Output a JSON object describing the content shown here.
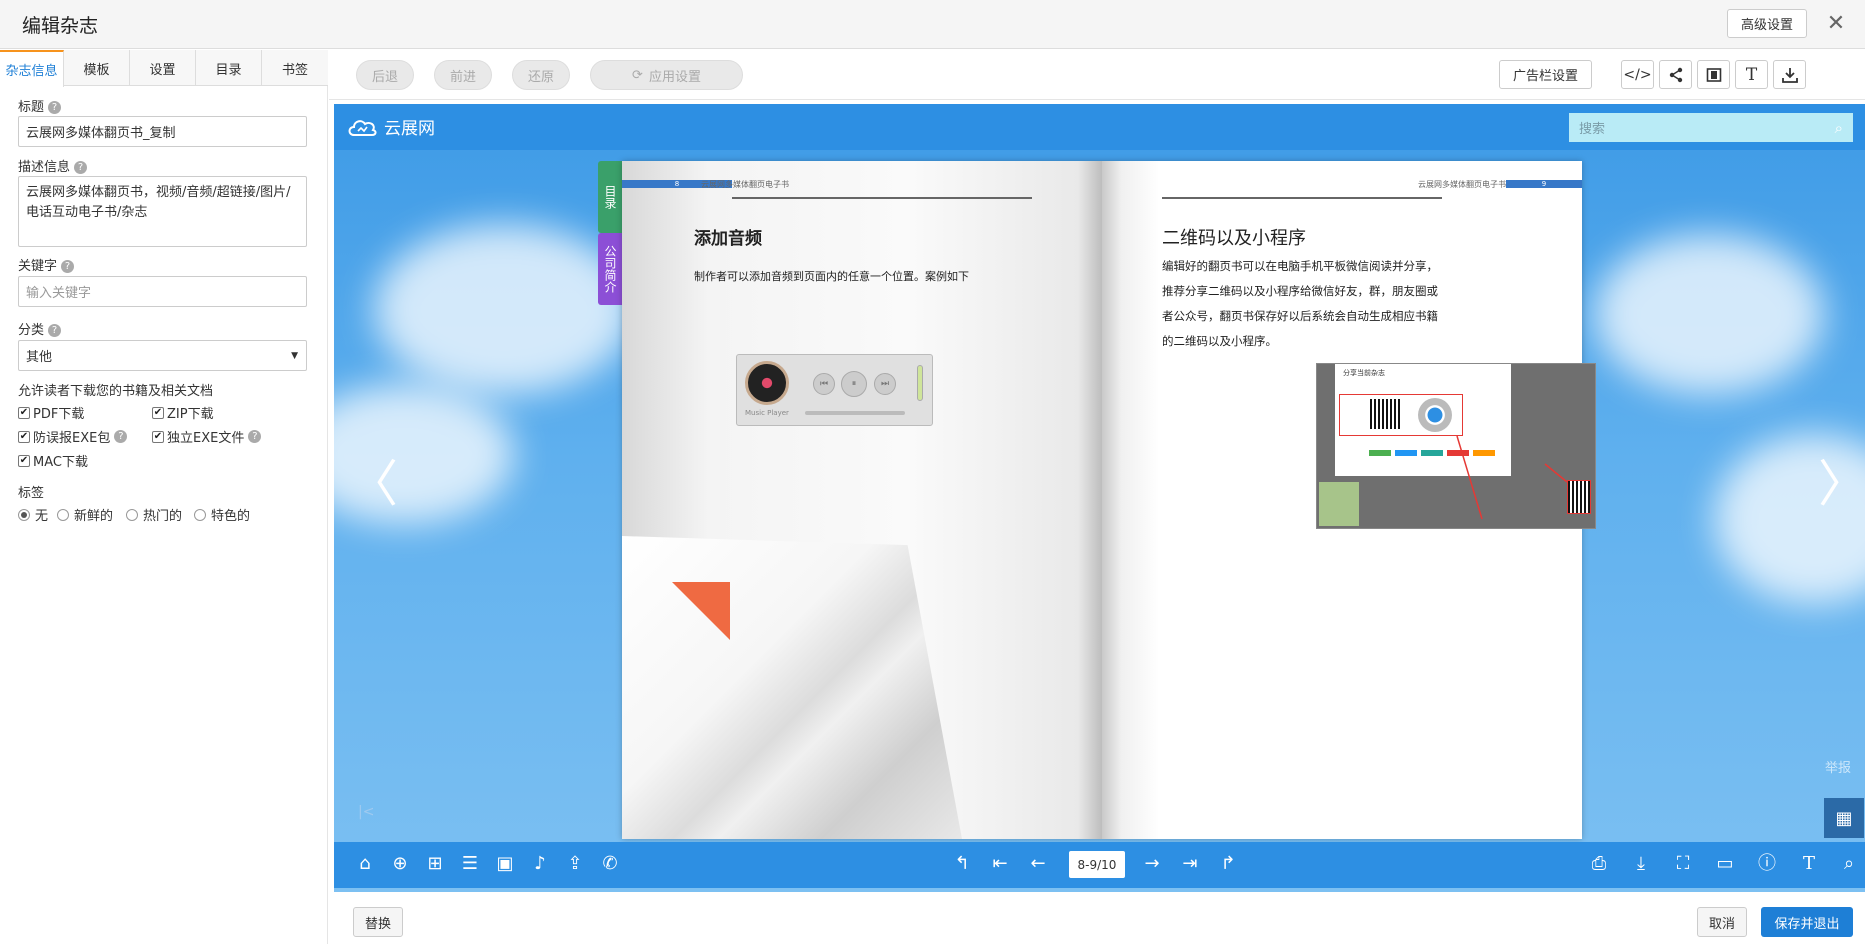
{
  "app": {
    "title": "编辑杂志",
    "advanced_button": "高级设置",
    "close_icon": "close-icon"
  },
  "left_panel": {
    "tabs": [
      "杂志信息",
      "模板",
      "设置",
      "目录",
      "书签"
    ],
    "active_tab": "杂志信息",
    "title_label": "标题",
    "title_value": "云展网多媒体翻页书_复制",
    "desc_label": "描述信息",
    "desc_value": "云展网多媒体翻页书，视频/音频/超链接/图片/电话互动电子书/杂志",
    "keyword_label": "关键字",
    "keyword_placeholder": "输入关键字",
    "category_label": "分类",
    "category_value": "其他",
    "download_label": "允许读者下载您的书籍及相关文档",
    "downloads": [
      {
        "label": "PDF下载",
        "checked": true
      },
      {
        "label": "ZIP下载",
        "checked": true
      },
      {
        "label": "防误报EXE包",
        "checked": true
      },
      {
        "label": "独立EXE文件",
        "checked": true
      },
      {
        "label": "MAC下载",
        "checked": true
      }
    ],
    "tag_label": "标签",
    "tags": [
      {
        "label": "无",
        "selected": true
      },
      {
        "label": "新鲜的",
        "selected": false
      },
      {
        "label": "热门的",
        "selected": false
      },
      {
        "label": "特色的",
        "selected": false
      }
    ]
  },
  "toolbar": {
    "back": "后退",
    "forward": "前进",
    "restore": "还原",
    "apply": "应用设置",
    "ad_settings": "广告栏设置",
    "icons": [
      "code-icon",
      "share-icon",
      "layout-icon",
      "text-icon",
      "download-icon"
    ]
  },
  "viewer": {
    "logo_text": "云展网",
    "search_placeholder": "搜索",
    "report": "举报",
    "page_indicator": "8-9/10",
    "side_tabs": [
      "目录",
      "公司简介"
    ],
    "left_page": {
      "page_number": "8",
      "running_head": "云展网多媒体翻页电子书",
      "heading": "添加音频",
      "text": "制作者可以添加音频到页面内的任意一个位置。案例如下",
      "player_label": "Music Player"
    },
    "right_page": {
      "page_number": "9",
      "running_head": "云展网多媒体翻页电子书",
      "heading": "二维码以及小程序",
      "text": "编辑好的翻页书可以在电脑手机平板微信阅读并分享，推荐分享二维码以及小程序给微信好友，群，朋友圈或者公众号，翻页书保存好以后系统会自动生成相应书籍的二维码以及小程序。",
      "shot_title": "分享当前杂志"
    }
  },
  "footer": {
    "replace": "替换",
    "cancel": "取消",
    "save_exit": "保存并退出"
  },
  "colors": {
    "accent": "#1e7fd6",
    "viewer_bar": "#2d8fe3",
    "tab_marker": "#f7931d",
    "side_tab_green": "#3aa06a",
    "side_tab_purple": "#8c4fd6"
  }
}
